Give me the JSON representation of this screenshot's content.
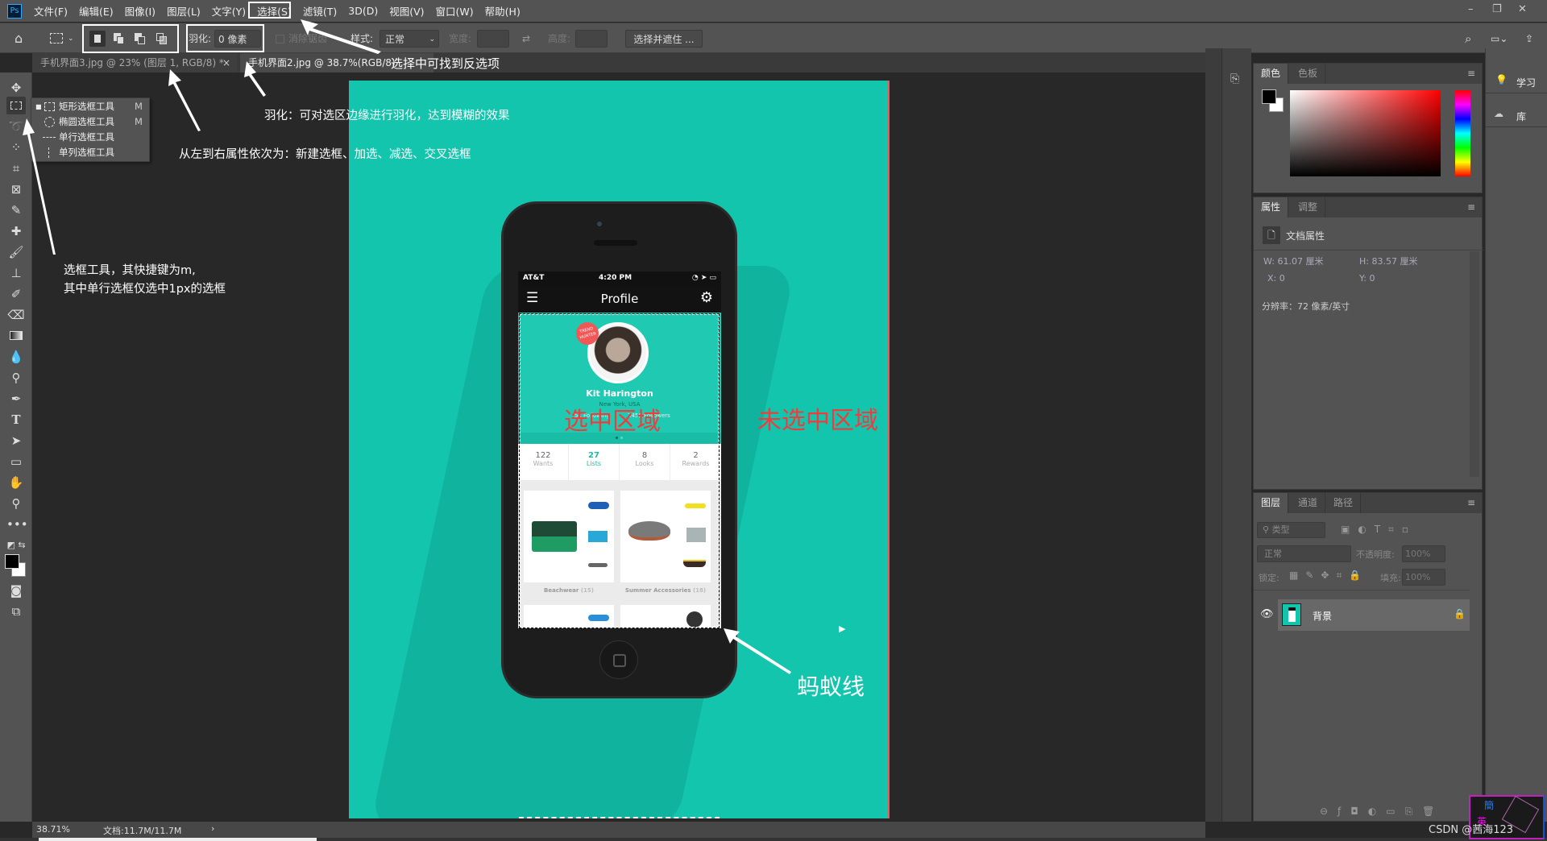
{
  "app": {
    "logo": "Ps",
    "menu": [
      "文件(F)",
      "编辑(E)",
      "图像(I)",
      "图层(L)",
      "文字(Y)",
      "选择(S)",
      "滤镜(T)",
      "3D(D)",
      "视图(V)",
      "窗口(W)",
      "帮助(H)"
    ]
  },
  "options": {
    "feather_label": "羽化:",
    "feather_value": "0 像素",
    "antialias": "消除锯齿",
    "style_label": "样式:",
    "style_value": "正常",
    "width_label": "宽度:",
    "height_label": "高度:",
    "select_mask": "选择并遮住 ..."
  },
  "tabs": [
    {
      "label": "手机界面3.jpg @ 23% (图层 1, RGB/8) *",
      "close": "×"
    },
    {
      "label": "手机界面2.jpg @ 38.7%(RGB/8)"
    }
  ],
  "flyout": [
    {
      "label": "矩形选框工具",
      "key": "M"
    },
    {
      "label": "椭圆选框工具",
      "key": "M"
    },
    {
      "label": "单行选框工具",
      "key": ""
    },
    {
      "label": "单列选框工具",
      "key": ""
    }
  ],
  "annotations": {
    "select_menu": "选择中可找到反选项",
    "feather": "羽化：可对选区边缘进行羽化，达到模糊的效果",
    "modes": "从左到右属性依次为：新建选框、加选、减选、交叉选框",
    "tool_line1": "选框工具，其快捷键为m,",
    "tool_line2": "其中单行选框仅选中1px的选框",
    "selected": "选中区域",
    "unselected": "未选中区域",
    "marching": "蚂蚁线"
  },
  "phone": {
    "carrier": "AT&T",
    "time": "4:20 PM",
    "title": "Profile",
    "badge": "TREND HUNTER",
    "name": "Kit Harington",
    "location": "New York, USA",
    "following": "51 Following",
    "followers": "2456 Followers",
    "stats": [
      {
        "value": "122",
        "label": "Wants"
      },
      {
        "value": "27",
        "label": "Lists"
      },
      {
        "value": "8",
        "label": "Looks"
      },
      {
        "value": "2",
        "label": "Rewards"
      }
    ],
    "lists": [
      {
        "name": "Beachwear",
        "count": "(15)"
      },
      {
        "name": "Summer Accessories",
        "count": "(18)"
      }
    ]
  },
  "color_panel": {
    "tabs": [
      "颜色",
      "色板"
    ]
  },
  "properties": {
    "tabs": [
      "属性",
      "调整"
    ],
    "doc_props": "文档属性",
    "w_label": "W:",
    "w_value": "61.07 厘米",
    "h_label": "H:",
    "h_value": "83.57 厘米",
    "x_label": "X:",
    "x_value": "0",
    "y_label": "Y:",
    "y_value": "0",
    "resolution": "分辨率：72 像素/英寸"
  },
  "layers": {
    "tabs": [
      "图层",
      "通道",
      "路径"
    ],
    "filter": "类型",
    "blend": "正常",
    "opacity_label": "不透明度:",
    "opacity": "100%",
    "lock_label": "锁定:",
    "fill_label": "填充:",
    "fill": "100%",
    "layer_name": "背景"
  },
  "far_right": {
    "learn": "学习",
    "library": "库"
  },
  "status": {
    "zoom": "38.71%",
    "doc": "文档:11.7M/11.7M"
  },
  "watermark": "CSDN @茜海123",
  "colors": {
    "canvas": "#14c5ad",
    "accent": "#31a8ff",
    "annotation_red": "#f03c3c"
  }
}
